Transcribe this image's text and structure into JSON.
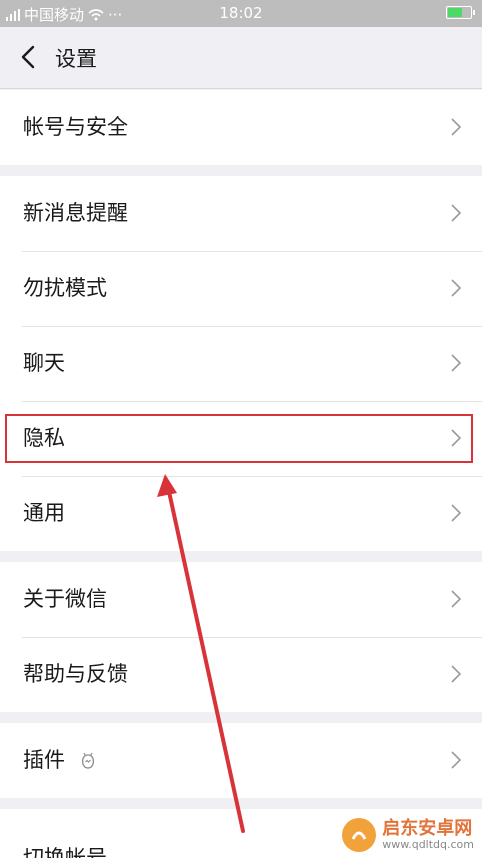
{
  "status_bar": {
    "carrier": "中国移动",
    "dots": "···",
    "time": "18:02"
  },
  "nav": {
    "title": "设置"
  },
  "groups": [
    {
      "items": [
        {
          "label": "帐号与安全"
        }
      ]
    },
    {
      "items": [
        {
          "label": "新消息提醒"
        },
        {
          "label": "勿扰模式"
        },
        {
          "label": "聊天"
        },
        {
          "label": "隐私"
        },
        {
          "label": "通用"
        }
      ]
    },
    {
      "items": [
        {
          "label": "关于微信"
        },
        {
          "label": "帮助与反馈"
        }
      ]
    },
    {
      "items": [
        {
          "label": "插件"
        }
      ]
    },
    {
      "items": [
        {
          "label": "切换帐号"
        }
      ]
    }
  ],
  "annotation": {
    "highlight_target": "隐私",
    "color": "#d9333a"
  },
  "watermark": {
    "name": "启东安卓网",
    "url": "www.qdltdq.com"
  }
}
